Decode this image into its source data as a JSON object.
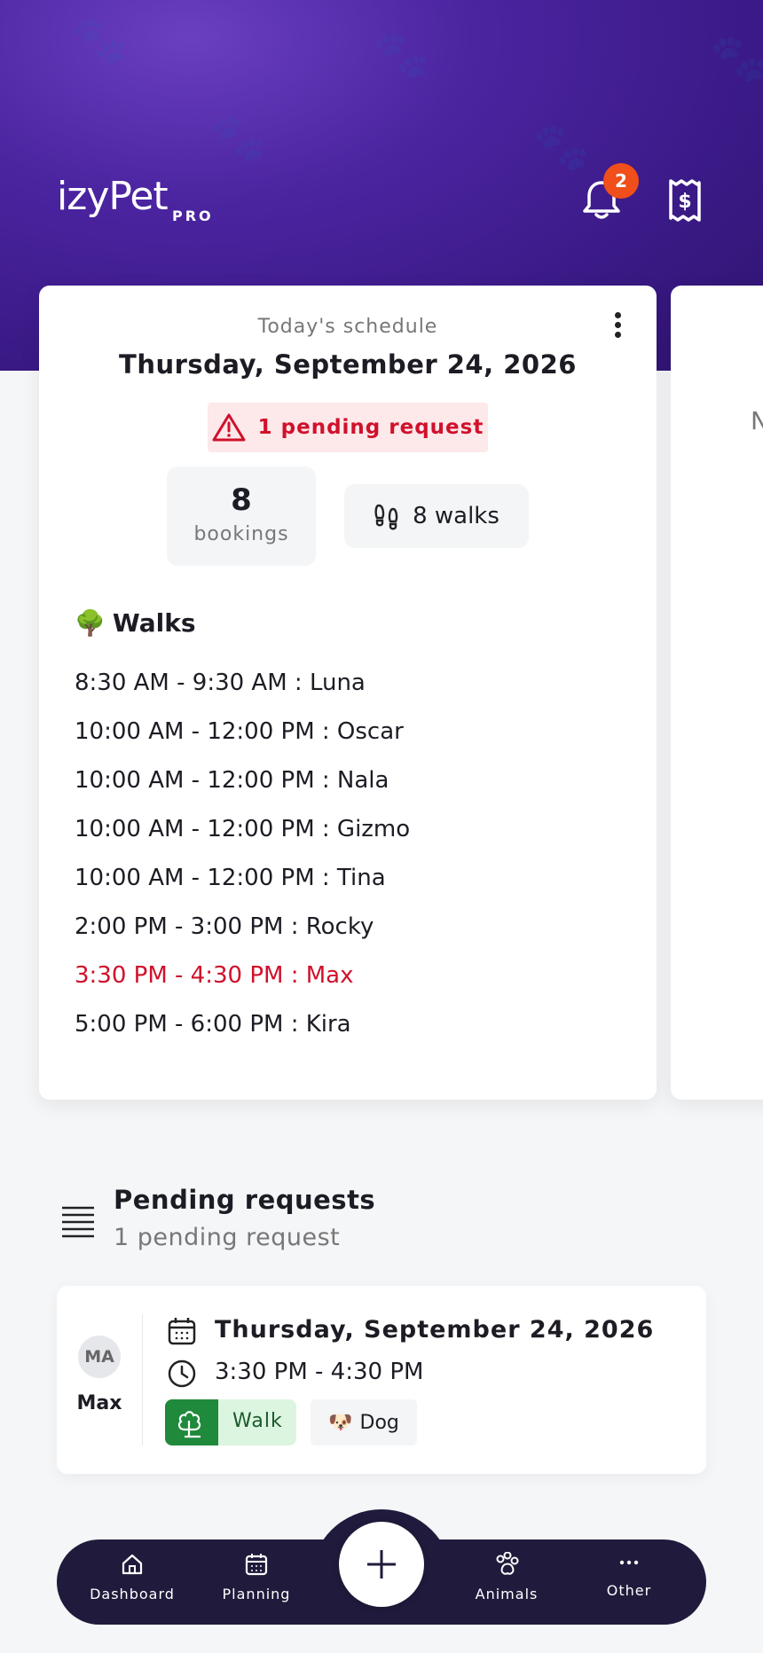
{
  "app": {
    "name": "izyPet",
    "tier": "PRO"
  },
  "header": {
    "notification_count": "2"
  },
  "schedule": {
    "label": "Today's schedule",
    "date": "Thursday, September 24, 2026",
    "pending_alert": "1 pending request",
    "bookings_count": "8",
    "bookings_label": "bookings",
    "walks_summary": "8 walks",
    "section_title": "Walks",
    "walks": [
      {
        "text": "8:30 AM - 9:30 AM : Luna",
        "pending": false
      },
      {
        "text": "10:00 AM - 12:00 PM : Oscar",
        "pending": false
      },
      {
        "text": "10:00 AM - 12:00 PM : Nala",
        "pending": false
      },
      {
        "text": "10:00 AM - 12:00 PM : Gizmo",
        "pending": false
      },
      {
        "text": "10:00 AM - 12:00 PM : Tina",
        "pending": false
      },
      {
        "text": "2:00 PM - 3:00 PM : Rocky",
        "pending": false
      },
      {
        "text": "3:30 PM - 4:30 PM : Max",
        "pending": true
      },
      {
        "text": "5:00 PM - 6:00 PM : Kira",
        "pending": false
      }
    ],
    "next_card_peek": "N"
  },
  "pending_requests": {
    "title": "Pending requests",
    "subtitle": "1 pending request",
    "items": [
      {
        "initials": "MA",
        "name": "Max",
        "date": "Thursday, September 24, 2026",
        "time": "3:30 PM - 4:30 PM",
        "service": "Walk",
        "species": "Dog"
      }
    ]
  },
  "nav": {
    "items": [
      "Dashboard",
      "Planning",
      "Animals",
      "Other"
    ]
  },
  "colors": {
    "brand_purple": "#4b24a0",
    "alert_red": "#d0112b",
    "badge_orange": "#f04e1a",
    "walk_green": "#1f8a3b",
    "nav_dark": "#201b3c"
  }
}
